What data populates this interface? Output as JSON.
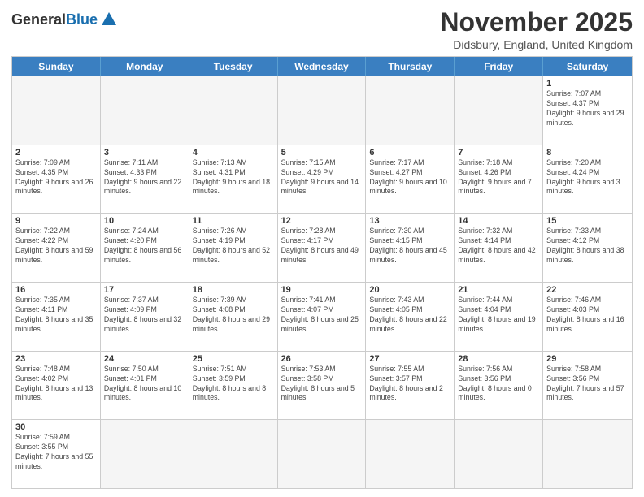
{
  "logo": {
    "general": "General",
    "blue": "Blue"
  },
  "header": {
    "title": "November 2025",
    "subtitle": "Didsbury, England, United Kingdom"
  },
  "weekdays": [
    "Sunday",
    "Monday",
    "Tuesday",
    "Wednesday",
    "Thursday",
    "Friday",
    "Saturday"
  ],
  "weeks": [
    [
      {
        "day": "",
        "empty": true
      },
      {
        "day": "",
        "empty": true
      },
      {
        "day": "",
        "empty": true
      },
      {
        "day": "",
        "empty": true
      },
      {
        "day": "",
        "empty": true
      },
      {
        "day": "",
        "empty": true
      },
      {
        "day": "1",
        "sunrise": "7:07 AM",
        "sunset": "4:37 PM",
        "daylight": "9 hours and 29 minutes."
      }
    ],
    [
      {
        "day": "2",
        "sunrise": "7:09 AM",
        "sunset": "4:35 PM",
        "daylight": "9 hours and 26 minutes."
      },
      {
        "day": "3",
        "sunrise": "7:11 AM",
        "sunset": "4:33 PM",
        "daylight": "9 hours and 22 minutes."
      },
      {
        "day": "4",
        "sunrise": "7:13 AM",
        "sunset": "4:31 PM",
        "daylight": "9 hours and 18 minutes."
      },
      {
        "day": "5",
        "sunrise": "7:15 AM",
        "sunset": "4:29 PM",
        "daylight": "9 hours and 14 minutes."
      },
      {
        "day": "6",
        "sunrise": "7:17 AM",
        "sunset": "4:27 PM",
        "daylight": "9 hours and 10 minutes."
      },
      {
        "day": "7",
        "sunrise": "7:18 AM",
        "sunset": "4:26 PM",
        "daylight": "9 hours and 7 minutes."
      },
      {
        "day": "8",
        "sunrise": "7:20 AM",
        "sunset": "4:24 PM",
        "daylight": "9 hours and 3 minutes."
      }
    ],
    [
      {
        "day": "9",
        "sunrise": "7:22 AM",
        "sunset": "4:22 PM",
        "daylight": "8 hours and 59 minutes."
      },
      {
        "day": "10",
        "sunrise": "7:24 AM",
        "sunset": "4:20 PM",
        "daylight": "8 hours and 56 minutes."
      },
      {
        "day": "11",
        "sunrise": "7:26 AM",
        "sunset": "4:19 PM",
        "daylight": "8 hours and 52 minutes."
      },
      {
        "day": "12",
        "sunrise": "7:28 AM",
        "sunset": "4:17 PM",
        "daylight": "8 hours and 49 minutes."
      },
      {
        "day": "13",
        "sunrise": "7:30 AM",
        "sunset": "4:15 PM",
        "daylight": "8 hours and 45 minutes."
      },
      {
        "day": "14",
        "sunrise": "7:32 AM",
        "sunset": "4:14 PM",
        "daylight": "8 hours and 42 minutes."
      },
      {
        "day": "15",
        "sunrise": "7:33 AM",
        "sunset": "4:12 PM",
        "daylight": "8 hours and 38 minutes."
      }
    ],
    [
      {
        "day": "16",
        "sunrise": "7:35 AM",
        "sunset": "4:11 PM",
        "daylight": "8 hours and 35 minutes."
      },
      {
        "day": "17",
        "sunrise": "7:37 AM",
        "sunset": "4:09 PM",
        "daylight": "8 hours and 32 minutes."
      },
      {
        "day": "18",
        "sunrise": "7:39 AM",
        "sunset": "4:08 PM",
        "daylight": "8 hours and 29 minutes."
      },
      {
        "day": "19",
        "sunrise": "7:41 AM",
        "sunset": "4:07 PM",
        "daylight": "8 hours and 25 minutes."
      },
      {
        "day": "20",
        "sunrise": "7:43 AM",
        "sunset": "4:05 PM",
        "daylight": "8 hours and 22 minutes."
      },
      {
        "day": "21",
        "sunrise": "7:44 AM",
        "sunset": "4:04 PM",
        "daylight": "8 hours and 19 minutes."
      },
      {
        "day": "22",
        "sunrise": "7:46 AM",
        "sunset": "4:03 PM",
        "daylight": "8 hours and 16 minutes."
      }
    ],
    [
      {
        "day": "23",
        "sunrise": "7:48 AM",
        "sunset": "4:02 PM",
        "daylight": "8 hours and 13 minutes."
      },
      {
        "day": "24",
        "sunrise": "7:50 AM",
        "sunset": "4:01 PM",
        "daylight": "8 hours and 10 minutes."
      },
      {
        "day": "25",
        "sunrise": "7:51 AM",
        "sunset": "3:59 PM",
        "daylight": "8 hours and 8 minutes."
      },
      {
        "day": "26",
        "sunrise": "7:53 AM",
        "sunset": "3:58 PM",
        "daylight": "8 hours and 5 minutes."
      },
      {
        "day": "27",
        "sunrise": "7:55 AM",
        "sunset": "3:57 PM",
        "daylight": "8 hours and 2 minutes."
      },
      {
        "day": "28",
        "sunrise": "7:56 AM",
        "sunset": "3:56 PM",
        "daylight": "8 hours and 0 minutes."
      },
      {
        "day": "29",
        "sunrise": "7:58 AM",
        "sunset": "3:56 PM",
        "daylight": "7 hours and 57 minutes."
      }
    ],
    [
      {
        "day": "30",
        "sunrise": "7:59 AM",
        "sunset": "3:55 PM",
        "daylight": "7 hours and 55 minutes."
      },
      {
        "day": "",
        "empty": true
      },
      {
        "day": "",
        "empty": true
      },
      {
        "day": "",
        "empty": true
      },
      {
        "day": "",
        "empty": true
      },
      {
        "day": "",
        "empty": true
      },
      {
        "day": "",
        "empty": true
      }
    ]
  ]
}
